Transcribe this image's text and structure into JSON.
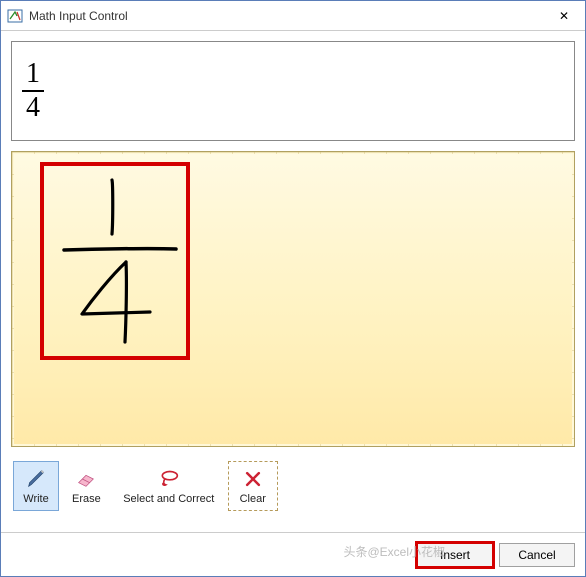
{
  "window": {
    "title": "Math Input Control",
    "close_glyph": "✕"
  },
  "preview": {
    "numerator": "1",
    "denominator": "4"
  },
  "ink": {
    "numerator": "1",
    "denominator": "4"
  },
  "tools": {
    "write": "Write",
    "erase": "Erase",
    "select_correct": "Select and Correct",
    "clear": "Clear"
  },
  "footer": {
    "watermark": "头条@Excel小花椒",
    "insert": "Insert",
    "cancel": "Cancel"
  }
}
